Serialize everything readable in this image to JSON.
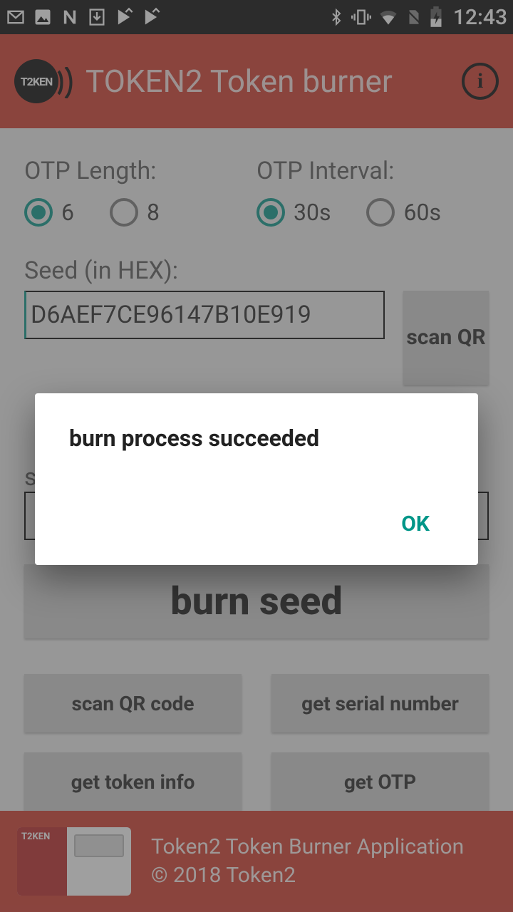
{
  "status": {
    "clock": "12:43"
  },
  "appbar": {
    "title": "TOKEN2 Token burner"
  },
  "otp_length": {
    "label": "OTP Length:",
    "options": [
      "6",
      "8"
    ],
    "selected": "6"
  },
  "otp_interval": {
    "label": "OTP Interval:",
    "options": [
      "30s",
      "60s"
    ],
    "selected": "30s"
  },
  "seed": {
    "label": "Seed (in HEX):",
    "value": "D6AEF7CE96147B10E919",
    "scan_label": "scan QR"
  },
  "serial": {
    "label_prefix": "s"
  },
  "burn": {
    "label": "burn seed"
  },
  "buttons": {
    "scan_qr": "scan QR code",
    "get_serial": "get serial number",
    "get_token_info": "get token info",
    "get_otp": "get OTP"
  },
  "footer": {
    "line1": "Token2 Token Burner Application",
    "line2": "© 2018 Token2"
  },
  "dialog": {
    "title": "burn process succeeded",
    "ok": "OK"
  }
}
